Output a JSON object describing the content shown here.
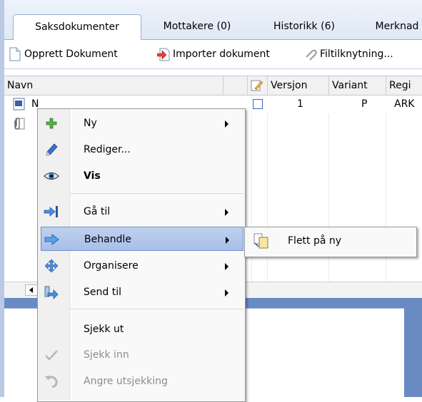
{
  "tabs": [
    {
      "label": "Saksdokumenter"
    },
    {
      "label": "Mottakere (0)"
    },
    {
      "label": "Historikk (6)"
    },
    {
      "label": "Merknad"
    }
  ],
  "toolbar": {
    "create_label": "Opprett Dokument",
    "import_label": "Importer dokument",
    "link_label": "Filtilknytning..."
  },
  "columns": {
    "name": "Navn",
    "version": "Versjon",
    "variant": "Variant",
    "reg": "Regi"
  },
  "rows": [
    {
      "name": "N",
      "version": "1",
      "variant": "P",
      "reg": "ARK"
    }
  ],
  "context_menu": {
    "items": [
      {
        "label": "Ny",
        "icon": "plus-icon",
        "submenu": true
      },
      {
        "label": "Rediger...",
        "icon": "pencil-icon",
        "submenu": false
      },
      {
        "label": "Vis",
        "icon": "eye-icon",
        "submenu": false
      },
      {
        "label": "Gå til",
        "icon": "goto-arrow-icon",
        "submenu": true
      },
      {
        "label": "Behandle",
        "icon": "process-arrow-icon",
        "submenu": true
      },
      {
        "label": "Organisere",
        "icon": "move-cross-icon",
        "submenu": true
      },
      {
        "label": "Send til",
        "icon": "send-to-icon",
        "submenu": true
      },
      {
        "label": "Sjekk ut",
        "icon": "",
        "submenu": false
      },
      {
        "label": "Sjekk inn",
        "icon": "checkmark-icon",
        "submenu": false
      },
      {
        "label": "Angre utsjekking",
        "icon": "undo-icon",
        "submenu": false
      }
    ]
  },
  "submenu": {
    "item_label": "Flett på ny",
    "icon": "merge-documents-icon"
  },
  "colors": {
    "highlight": "#b3c7ec",
    "accent_blue": "#6a8ac4"
  }
}
